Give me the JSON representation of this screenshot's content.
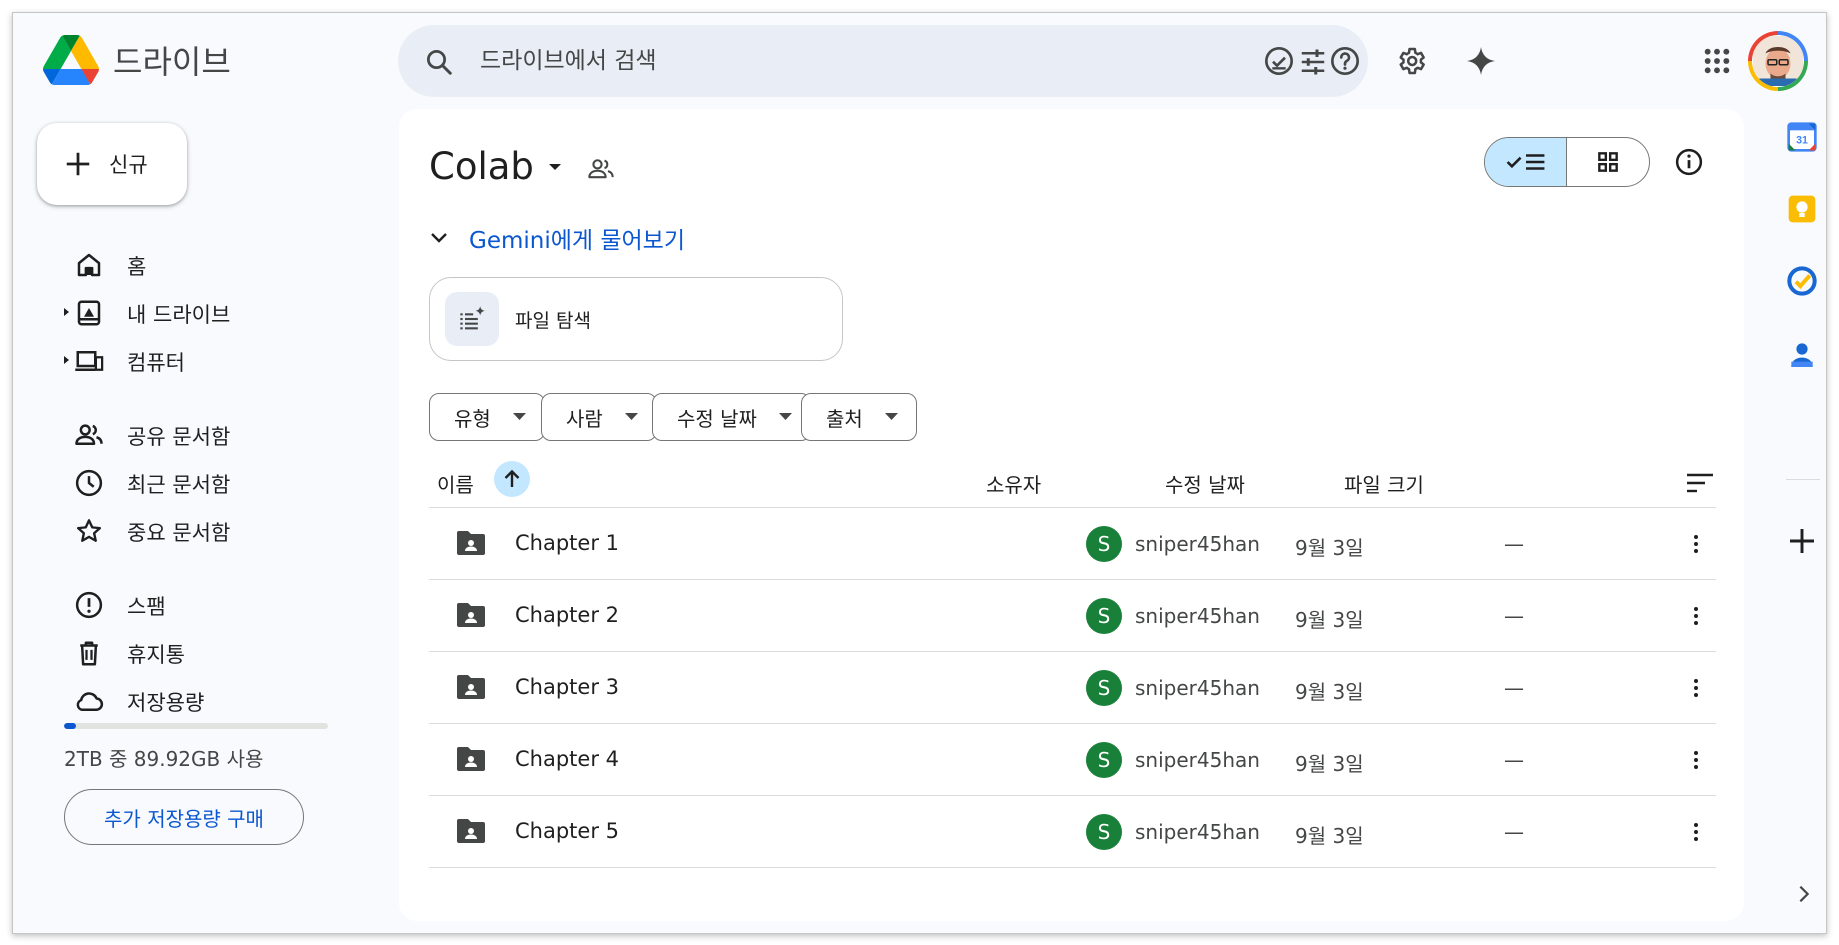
{
  "app": {
    "name": "드라이브"
  },
  "search": {
    "placeholder": "드라이브에서 검색"
  },
  "header_icons": [
    "offline-check-icon",
    "help-icon",
    "settings-icon",
    "gemini-sparkle-icon",
    "apps-grid-icon"
  ],
  "new_button": {
    "label": "신규"
  },
  "nav": {
    "items": [
      {
        "label": "홈",
        "icon": "home-icon"
      },
      {
        "label": "내 드라이브",
        "icon": "my-drive-icon"
      },
      {
        "label": "컴퓨터",
        "icon": "computers-icon"
      },
      {
        "label": "공유 문서함",
        "icon": "shared-people-icon"
      },
      {
        "label": "최근 문서함",
        "icon": "clock-icon"
      },
      {
        "label": "중요 문서함",
        "icon": "star-icon"
      },
      {
        "label": "스팸",
        "icon": "spam-icon"
      },
      {
        "label": "휴지통",
        "icon": "trash-icon"
      },
      {
        "label": "저장용량",
        "icon": "cloud-icon"
      }
    ]
  },
  "storage": {
    "used_fraction": 0.044,
    "text": "2TB 중 89.92GB 사용",
    "buy_label": "추가 저장용량 구매"
  },
  "main": {
    "folder_title": "Colab",
    "gemini_label": "Gemini에게 물어보기",
    "explore_label": "파일 탐색",
    "filters": [
      "유형",
      "사람",
      "수정 날짜",
      "출처"
    ],
    "columns": {
      "name": "이름",
      "owner": "소유자",
      "modified": "수정 날짜",
      "size": "파일 크기"
    },
    "rows": [
      {
        "name": "Chapter 1",
        "owner_initial": "S",
        "owner": "sniper45han",
        "modified": "9월 3일",
        "size": "—"
      },
      {
        "name": "Chapter 2",
        "owner_initial": "S",
        "owner": "sniper45han",
        "modified": "9월 3일",
        "size": "—"
      },
      {
        "name": "Chapter 3",
        "owner_initial": "S",
        "owner": "sniper45han",
        "modified": "9월 3일",
        "size": "—"
      },
      {
        "name": "Chapter 4",
        "owner_initial": "S",
        "owner": "sniper45han",
        "modified": "9월 3일",
        "size": "—"
      },
      {
        "name": "Chapter 5",
        "owner_initial": "S",
        "owner": "sniper45han",
        "modified": "9월 3일",
        "size": "—"
      }
    ]
  },
  "side_panel": {
    "apps": [
      "calendar-icon",
      "keep-icon",
      "tasks-icon",
      "contacts-icon"
    ],
    "calendar_day": "31"
  },
  "colors": {
    "accent": "#0b57d0",
    "selected": "#c2e7ff",
    "owner_avatar": "#188038"
  }
}
